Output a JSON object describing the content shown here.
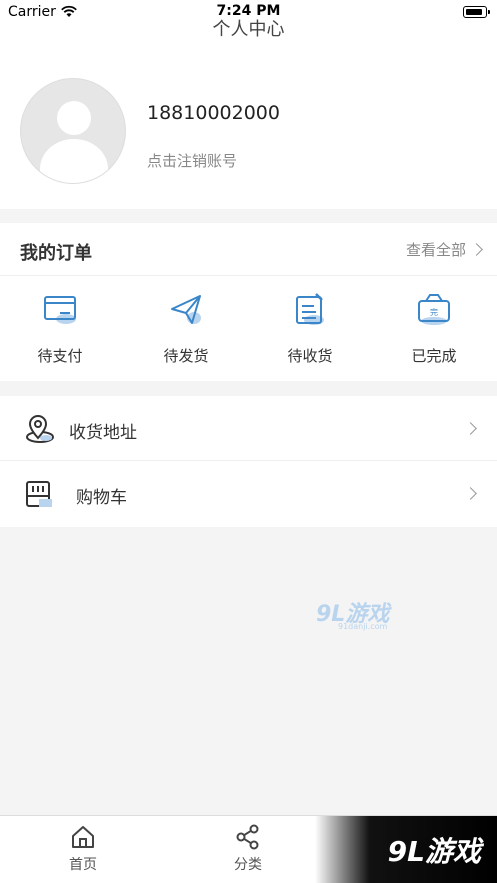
{
  "status_bar": {
    "carrier": "Carrier",
    "time": "7:24 PM"
  },
  "nav": {
    "title": "个人中心"
  },
  "profile": {
    "phone": "18810002000",
    "logout_link": "点击注销账号"
  },
  "orders": {
    "title": "我的订单",
    "view_all": "查看全部",
    "items": [
      {
        "label": "待支付",
        "icon": "card-icon"
      },
      {
        "label": "待发货",
        "icon": "paper-plane-icon"
      },
      {
        "label": "待收货",
        "icon": "document-edit-icon"
      },
      {
        "label": "已完成",
        "icon": "ticket-done-icon"
      }
    ]
  },
  "menu": {
    "items": [
      {
        "label": "收货地址",
        "icon": "location-pin-icon"
      },
      {
        "label": "购物车",
        "icon": "storefront-icon"
      }
    ]
  },
  "watermark": {
    "text": "9L游戏",
    "sub": "91danji.com"
  },
  "tab_bar": {
    "items": [
      {
        "label": "首页",
        "icon": "home-icon"
      },
      {
        "label": "分类",
        "icon": "share-icon"
      }
    ],
    "brand": "9L游戏"
  },
  "colors": {
    "accent": "#3a86c8",
    "accent_light": "#b9d4ee",
    "background": "#f4f4f4"
  }
}
